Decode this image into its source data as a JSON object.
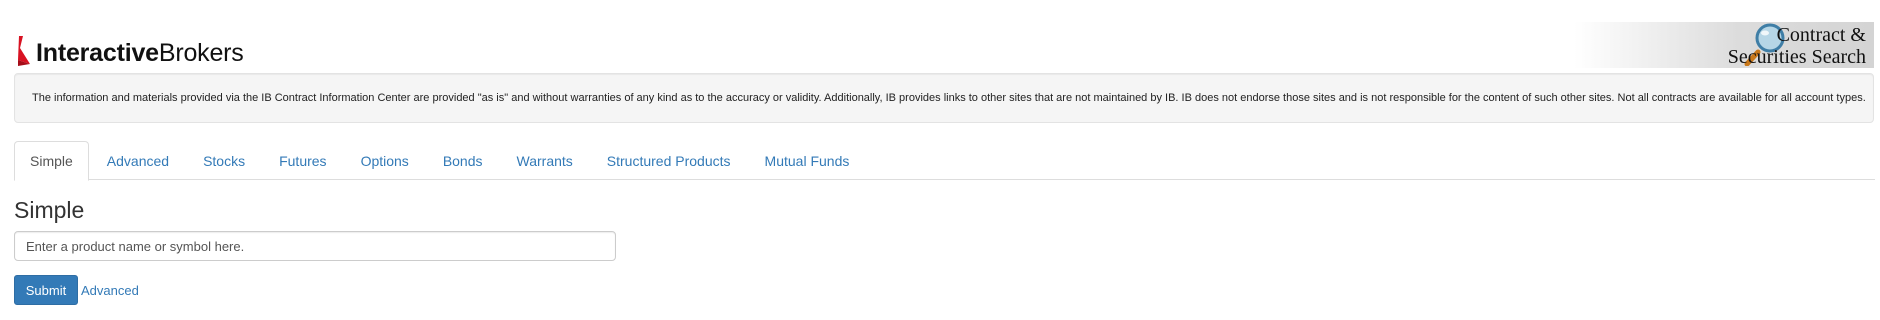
{
  "header": {
    "logo_bold": "Interactive",
    "logo_regular": "Brokers",
    "banner_line1": "Contract &",
    "banner_line2": "Securities Search",
    "brand_color": "#d81222"
  },
  "disclaimer": {
    "text": "The information and materials provided via the IB Contract Information Center are provided \"as is\" and without warranties of any kind as to the accuracy or validity. Additionally, IB provides links to other sites that are not maintained by IB. IB does not endorse those sites and is not responsible for the content of such other sites. Not all contracts are available for all account types."
  },
  "tabs": [
    {
      "label": "Simple",
      "active": true
    },
    {
      "label": "Advanced",
      "active": false
    },
    {
      "label": "Stocks",
      "active": false
    },
    {
      "label": "Futures",
      "active": false
    },
    {
      "label": "Options",
      "active": false
    },
    {
      "label": "Bonds",
      "active": false
    },
    {
      "label": "Warrants",
      "active": false
    },
    {
      "label": "Structured Products",
      "active": false
    },
    {
      "label": "Mutual Funds",
      "active": false
    }
  ],
  "main": {
    "title": "Simple",
    "search_placeholder": "Enter a product name or symbol here.",
    "search_value": "",
    "submit_label": "Submit",
    "advanced_link": "Advanced"
  },
  "colors": {
    "link": "#337ab7",
    "primary_button": "#337ab7"
  }
}
